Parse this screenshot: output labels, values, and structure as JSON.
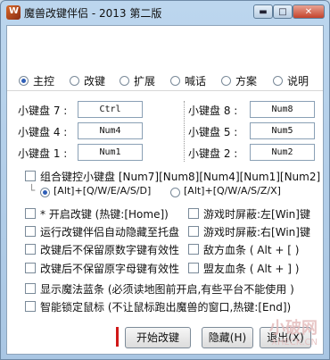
{
  "window": {
    "title": "魔兽改键伴侣 - 2013 第二版",
    "min_label": "▬",
    "max_label": "□",
    "close_label": "✕"
  },
  "tabs": [
    {
      "label": "主控",
      "selected": true
    },
    {
      "label": "改键",
      "selected": false
    },
    {
      "label": "扩展",
      "selected": false
    },
    {
      "label": "喊话",
      "selected": false
    },
    {
      "label": "方案",
      "selected": false
    },
    {
      "label": "说明",
      "selected": false
    }
  ],
  "keypad": {
    "left": [
      {
        "label": "小键盘 7 :",
        "value": "Ctrl"
      },
      {
        "label": "小键盘 4 :",
        "value": "Num4"
      },
      {
        "label": "小键盘 1 :",
        "value": "Num1"
      }
    ],
    "right": [
      {
        "label": "小键盘 8 :",
        "value": "Num8"
      },
      {
        "label": "小键盘 5 :",
        "value": "Num5"
      },
      {
        "label": "小键盘 2 :",
        "value": "Num2"
      }
    ]
  },
  "combo": {
    "label": "组合键控小键盘 [Num7][Num8][Num4][Num1][Num2]",
    "connector": "└",
    "option_a": "[Alt]+[Q/W/E/A/S/D]",
    "option_b": "[Alt]+[Q/W/A/S/Z/X]"
  },
  "options_left": [
    "* 开启改键 (热键:[Home])",
    "运行改键伴侣自动隐藏至托盘",
    "改键后不保留原数字键有效性",
    "改键后不保留原字母键有效性"
  ],
  "options_right": [
    "游戏时屏蔽:左[Win]键",
    "游戏时屏蔽:右[Win]键",
    "敌方血条 ( Alt + [ )",
    "盟友血条 ( Alt + ] )"
  ],
  "options_wide": [
    "显示魔法蓝条 (必须读地图前开启,有些平台不能使用 )",
    "智能锁定鼠标 (不让鼠标跑出魔兽的窗口,热键:[End])"
  ],
  "buttons": {
    "start": "开始改键",
    "hide": "隐藏(H)",
    "exit": "退出(X)"
  },
  "watermark": {
    "main": "小破网",
    "sub": "XHECK.CN"
  }
}
